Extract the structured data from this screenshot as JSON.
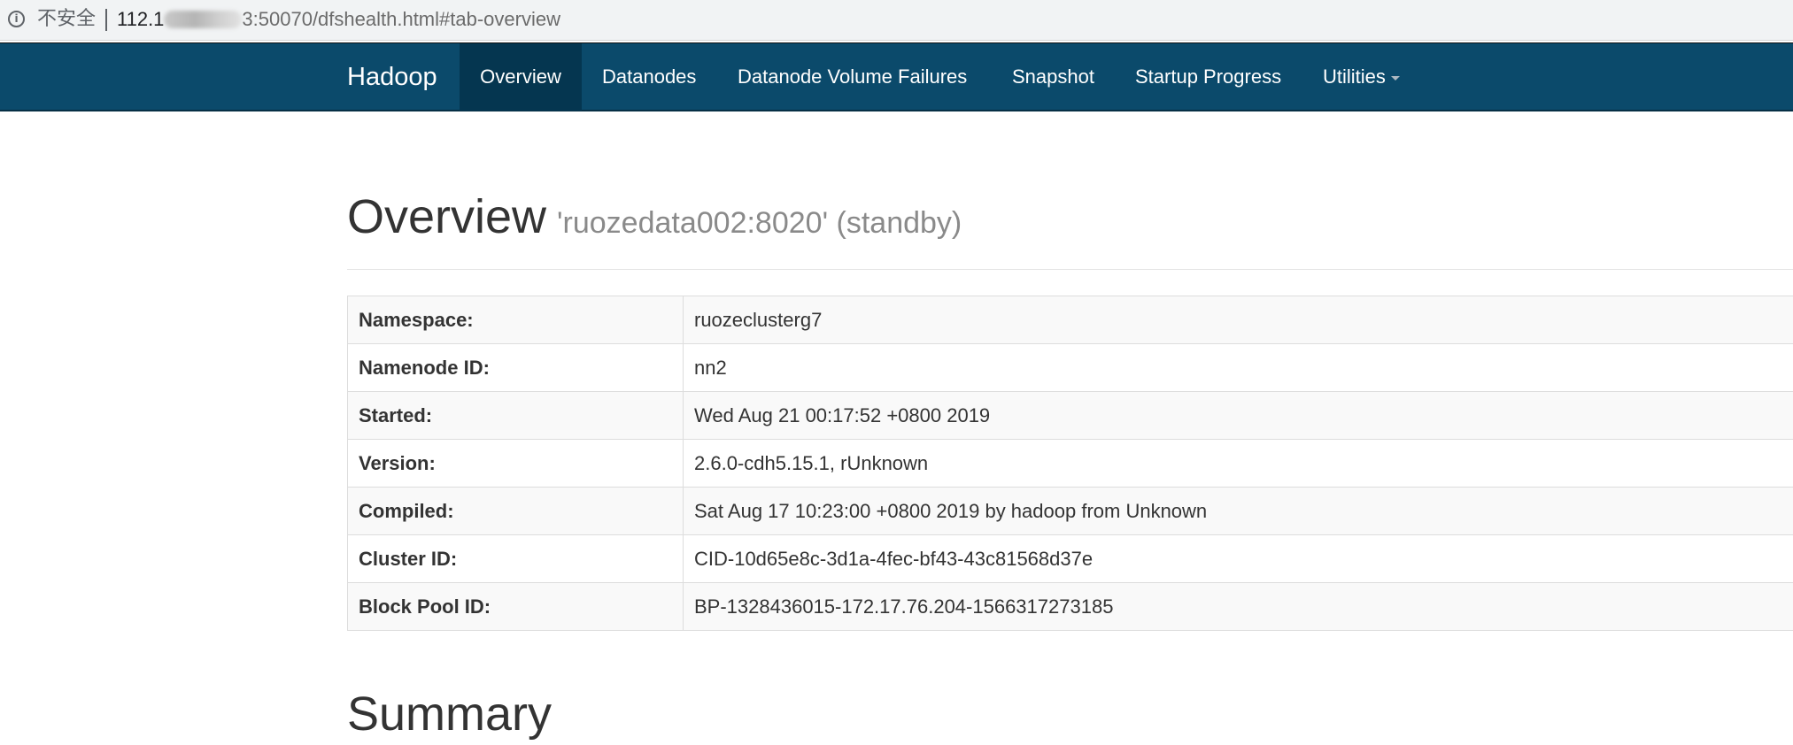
{
  "browser": {
    "security_label": "不安全",
    "url_host": "112.1",
    "url_rest": "3:50070/dfshealth.html#tab-overview"
  },
  "navbar": {
    "brand": "Hadoop",
    "items": [
      {
        "label": "Overview",
        "active": true
      },
      {
        "label": "Datanodes"
      },
      {
        "label": "Datanode Volume Failures"
      },
      {
        "label": "Snapshot"
      },
      {
        "label": "Startup Progress"
      },
      {
        "label": "Utilities",
        "dropdown": true
      }
    ]
  },
  "overview": {
    "title": "Overview",
    "subtitle": "'ruozedata002:8020' (standby)",
    "rows": [
      {
        "key": "Namespace:",
        "value": "ruozeclusterg7"
      },
      {
        "key": "Namenode ID:",
        "value": "nn2"
      },
      {
        "key": "Started:",
        "value": "Wed Aug 21 00:17:52 +0800 2019"
      },
      {
        "key": "Version:",
        "value": "2.6.0-cdh5.15.1, rUnknown"
      },
      {
        "key": "Compiled:",
        "value": "Sat Aug 17 10:23:00 +0800 2019 by hadoop from Unknown"
      },
      {
        "key": "Cluster ID:",
        "value": "CID-10d65e8c-3d1a-4fec-bf43-43c81568d37e"
      },
      {
        "key": "Block Pool ID:",
        "value": "BP-1328436015-172.17.76.204-1566317273185"
      }
    ]
  },
  "summary": {
    "title": "Summary"
  },
  "colors": {
    "navbar": "#0b4a6b",
    "navbar_active": "#053650"
  }
}
